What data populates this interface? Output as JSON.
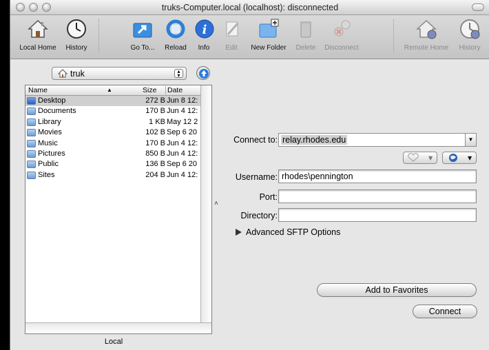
{
  "window": {
    "title": "truks-Computer.local (localhost): disconnected"
  },
  "toolbar": {
    "local_home": "Local Home",
    "history_left": "History",
    "go_to": "Go To...",
    "reload": "Reload",
    "info": "Info",
    "edit": "Edit",
    "new_folder": "New Folder",
    "delete": "Delete",
    "disconnect": "Disconnect",
    "remote_home": "Remote Home",
    "history_right": "History"
  },
  "local": {
    "path_popup": "truk",
    "columns": {
      "name": "Name",
      "size": "Size",
      "date": "Date"
    },
    "files": [
      {
        "name": "Desktop",
        "size": "272 B",
        "date": "Jun 8 12:",
        "selected": true
      },
      {
        "name": "Documents",
        "size": "170 B",
        "date": "Jun 4 12:"
      },
      {
        "name": "Library",
        "size": "1 KB",
        "date": "May 12 2"
      },
      {
        "name": "Movies",
        "size": "102 B",
        "date": "Sep 6 20"
      },
      {
        "name": "Music",
        "size": "170 B",
        "date": "Jun 4 12:"
      },
      {
        "name": "Pictures",
        "size": "850 B",
        "date": "Jun 4 12:"
      },
      {
        "name": "Public",
        "size": "136 B",
        "date": "Sep 6 20"
      },
      {
        "name": "Sites",
        "size": "204 B",
        "date": "Jun 4 12:"
      }
    ],
    "footer_label": "Local"
  },
  "connect": {
    "connect_to_label": "Connect to:",
    "connect_to_value": "relay.rhodes.edu",
    "username_label": "Username:",
    "username_value": "rhodes\\pennington",
    "port_label": "Port:",
    "port_value": "",
    "directory_label": "Directory:",
    "directory_value": "",
    "advanced_label": "Advanced SFTP Options",
    "add_favorites": "Add to Favorites",
    "connect_button": "Connect"
  },
  "colors": {
    "selection_row": "#cfcfcf",
    "window_bg": "#e6e6e6"
  }
}
